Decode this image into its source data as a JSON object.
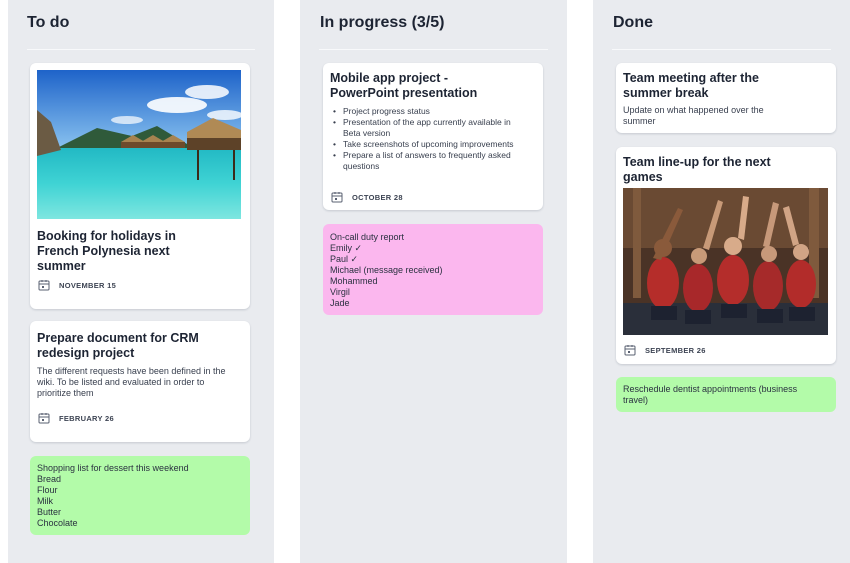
{
  "columns": {
    "todo": {
      "title": "To do",
      "card1": {
        "title": "Booking for holidays in French Polynesia next summer",
        "date": "NOVEMBER 15"
      },
      "card2": {
        "title": "Prepare document for CRM redesign project",
        "description": "The different requests have been defined in the wiki. To be listed and evaluated in order to prioritize them",
        "date": "FEBRUARY 26"
      },
      "note": {
        "title": "Shopping list for dessert this weekend",
        "items": [
          "Bread",
          "Flour",
          "Milk",
          "Butter",
          "Chocolate"
        ],
        "color": "#b3fba9"
      }
    },
    "progress": {
      "title": "In progress (3/5)",
      "card1": {
        "title": "Mobile app project - PowerPoint presentation",
        "bullets": [
          "Project progress status",
          "Presentation of the app currently available in Beta version",
          "Take screenshots of upcoming improvements",
          "Prepare a list of answers to frequently asked questions"
        ],
        "date": "OCTOBER 28"
      },
      "note": {
        "title": "On-call duty report",
        "items": [
          "Emily ✓",
          "Paul ✓",
          "Michael (message received)",
          "Mohammed",
          "Virgil",
          "Jade"
        ],
        "color": "#fbb7ee"
      }
    },
    "done": {
      "title": "Done",
      "card1": {
        "title": "Team meeting after the summer break",
        "description": "Update on what happened over the summer"
      },
      "card2": {
        "title": "Team line-up for the next games",
        "date": "SEPTEMBER 26"
      },
      "note": {
        "text": "Reschedule dentist appointments (business travel)",
        "color": "#b3fba9"
      }
    }
  }
}
